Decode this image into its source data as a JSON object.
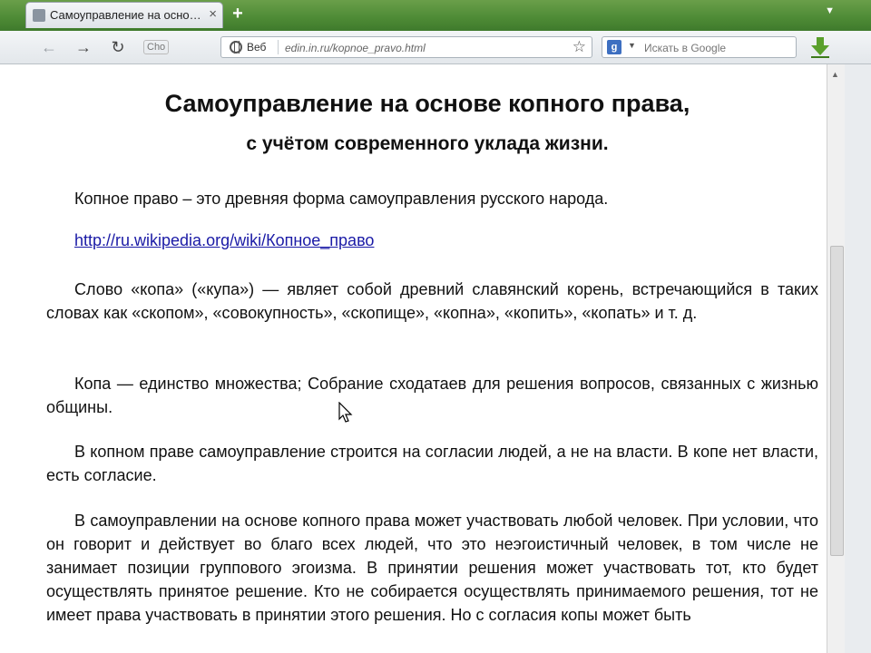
{
  "tab": {
    "title": "Самоуправление на осно…",
    "close_glyph": "×",
    "new_glyph": "+",
    "menu_glyph": "▼"
  },
  "toolbar": {
    "back_glyph": "←",
    "forward_glyph": "→",
    "reload_glyph": "↻",
    "speed_label": "Сhо",
    "url_label": "Веб",
    "url": "edin.in.ru/kopnoe_pravo.html",
    "star_glyph": "☆",
    "search_placeholder": "Искать в Google",
    "search_engine_letter": "g",
    "search_chev": "▼"
  },
  "page": {
    "title": "Самоуправление на основе копного права,",
    "subtitle": "с учётом современного уклада жизни.",
    "p1": "Копное право – это древняя форма самоуправления русского народа.",
    "link": "http://ru.wikipedia.org/wiki/Копное_право",
    "p3": "Слово «копа» («купа») — являет собой древний славянский корень, встречающийся в таких словах как «скопом», «совокупность», «скопище», «копна», «копить», «копать» и т. д.",
    "p4": "Копа — единство множества; Собрание сходатаев для решения вопросов, связанных с жизнью общины.",
    "p5": "В копном праве самоуправление строится на согласии людей, а не на власти. В копе нет власти, есть согласие.",
    "p6": "В самоуправлении на основе копного права может участвовать любой человек. При условии, что он говорит и действует во благо всех людей, что это неэгоистичный человек, в том числе не занимает позиции группового эгоизма. В принятии решения может участвовать тот, кто будет осуществлять принятое решение. Кто не собирается осуществлять принимаемого решения, тот не имеет права участвовать в принятии этого решения. Но с согласия копы может быть"
  },
  "scrollbar": {
    "up_glyph": "▲"
  },
  "colors": {
    "link": "#1a1aa6",
    "tabstrip": "#4d8a35",
    "download": "#5aa02c"
  }
}
